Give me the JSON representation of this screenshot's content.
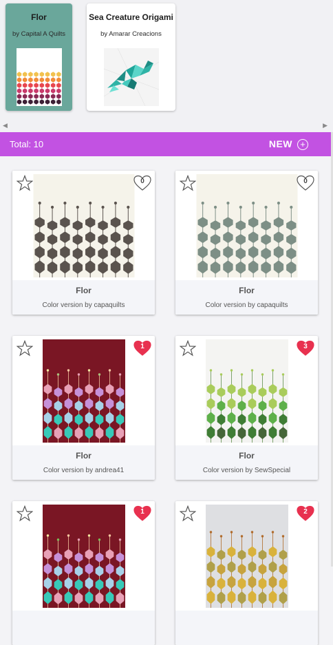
{
  "patterns": [
    {
      "title": "Flor",
      "author": "by Capital A Quilts"
    },
    {
      "title": "Sea Creature Origami",
      "author": "by Amarar Creacions"
    }
  ],
  "toolbar": {
    "total_label": "Total: 10",
    "new_label": "NEW",
    "plus_glyph": "+"
  },
  "cards": [
    {
      "name": "Flor",
      "subtitle": "Color version by capaquilts",
      "likes": "0"
    },
    {
      "name": "Flor",
      "subtitle": "Color version by capaquilts",
      "likes": "0"
    },
    {
      "name": "Flor",
      "subtitle": "Color version by andrea41",
      "likes": "1"
    },
    {
      "name": "Flor",
      "subtitle": "Color version by SewSpecial",
      "likes": "3"
    },
    {
      "name": "",
      "subtitle": "",
      "likes": "1"
    },
    {
      "name": "",
      "subtitle": "",
      "likes": "2"
    }
  ],
  "colors": {
    "accent": "#c252e2",
    "selected_card": "#6aa79b",
    "heart": "#e8314f"
  },
  "icons": {
    "favorite": "star-outline-icon",
    "like": "heart-icon",
    "add": "plus-circle-icon"
  }
}
